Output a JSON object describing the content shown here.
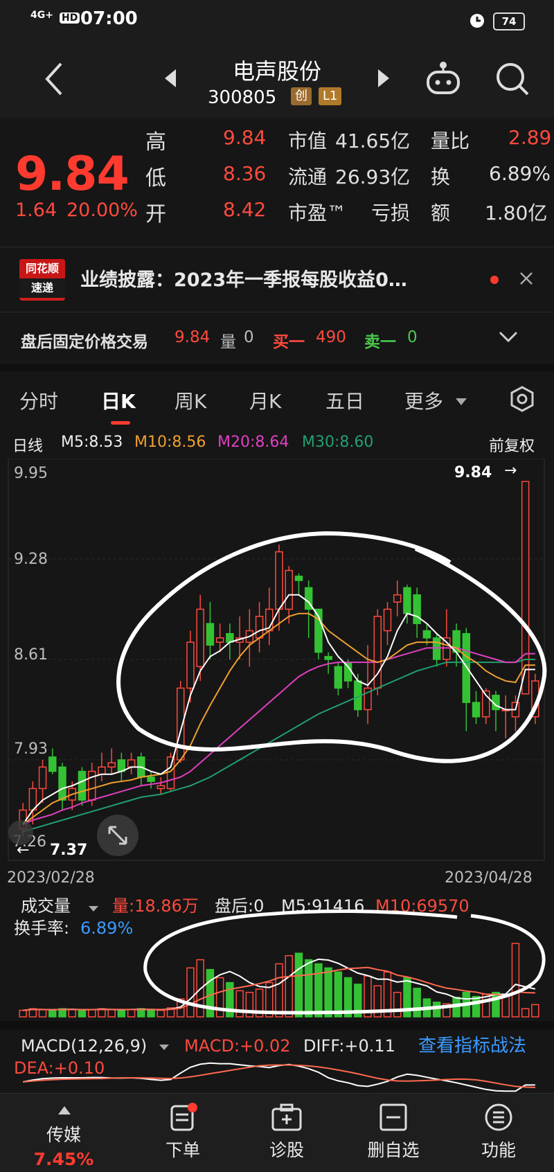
{
  "status": {
    "network": "4G+",
    "hd": "HD",
    "time": "07:00",
    "battery": "74"
  },
  "nav": {
    "title": "电声股份",
    "code": "300805",
    "board_tag": "创",
    "level_tag": "L1"
  },
  "quote": {
    "price": "9.84",
    "change": "1.64",
    "change_pct": "20.00%",
    "rows": [
      {
        "label": "高",
        "value": "9.84",
        "k2": "市值",
        "v2": "41.65亿",
        "k3": "量比",
        "v3": "2.89"
      },
      {
        "label": "低",
        "value": "8.36",
        "k2": "流通",
        "v2": "26.93亿",
        "k3": "换",
        "v3": "6.89%"
      },
      {
        "label": "开",
        "value": "8.42",
        "k2": "市盈™",
        "v2": "亏损",
        "k3": "额",
        "v3": "1.80亿"
      }
    ]
  },
  "news": {
    "logo_top": "同花顺",
    "logo_bottom": "速递",
    "text": "业绩披露：2023年一季报每股收益0…"
  },
  "after_hours": {
    "label": "盘后固定价格交易",
    "price": "9.84",
    "vol_label": "量",
    "vol": "0",
    "buy_label": "买一",
    "buy": "490",
    "sell_label": "卖一",
    "sell": "0"
  },
  "tabs": [
    "分时",
    "日K",
    "周K",
    "月K",
    "五日",
    "更多"
  ],
  "legend": {
    "line": "日线",
    "m5": "M5:8.53",
    "m10": "M10:8.56",
    "m20": "M20:8.64",
    "m30": "M30:8.60",
    "adjust": "前复权"
  },
  "colors": {
    "up": "#ff4a3d",
    "down": "#34c234",
    "m5": "#ffffff",
    "m10": "#f0a030",
    "m20": "#e040c0",
    "m30": "#20a070"
  },
  "chart_data": {
    "type": "candlestick",
    "y_ticks": [
      "9.95",
      "9.28",
      "8.61",
      "7.93",
      "7.26"
    ],
    "ylim": [
      7.2,
      10.0
    ],
    "x_start": "2023/02/28",
    "x_end": "2023/04/28",
    "high_label": "9.84",
    "low_label": "7.37",
    "candles": [
      [
        7.42,
        7.55,
        7.37,
        7.6
      ],
      [
        7.55,
        7.7,
        7.45,
        7.75
      ],
      [
        7.7,
        7.85,
        7.6,
        7.9
      ],
      [
        7.92,
        7.82,
        7.8,
        7.98
      ],
      [
        7.85,
        7.62,
        7.55,
        7.88
      ],
      [
        7.62,
        7.7,
        7.55,
        7.75
      ],
      [
        7.82,
        7.62,
        7.58,
        7.85
      ],
      [
        7.62,
        7.82,
        7.58,
        7.88
      ],
      [
        7.8,
        7.85,
        7.75,
        7.95
      ],
      [
        7.85,
        7.88,
        7.8,
        7.98
      ],
      [
        7.9,
        7.82,
        7.75,
        7.95
      ],
      [
        7.85,
        7.9,
        7.8,
        7.95
      ],
      [
        7.92,
        7.78,
        7.72,
        7.95
      ],
      [
        7.78,
        7.75,
        7.7,
        7.82
      ],
      [
        7.7,
        7.72,
        7.66,
        7.78
      ],
      [
        7.7,
        7.92,
        7.68,
        7.95
      ],
      [
        7.9,
        8.4,
        7.88,
        8.45
      ],
      [
        8.4,
        8.72,
        8.3,
        8.8
      ],
      [
        8.55,
        8.95,
        8.45,
        9.05
      ],
      [
        8.85,
        8.7,
        8.6,
        9.0
      ],
      [
        8.72,
        8.75,
        8.65,
        8.85
      ],
      [
        8.78,
        8.72,
        8.6,
        8.85
      ],
      [
        8.72,
        8.75,
        8.6,
        8.9
      ],
      [
        8.72,
        8.8,
        8.55,
        8.95
      ],
      [
        8.75,
        8.9,
        8.65,
        9.0
      ],
      [
        8.8,
        8.95,
        8.7,
        9.1
      ],
      [
        8.95,
        9.35,
        8.8,
        9.4
      ],
      [
        8.95,
        9.22,
        8.85,
        9.25
      ],
      [
        9.18,
        9.15,
        9.05,
        9.2
      ],
      [
        9.1,
        8.95,
        8.75,
        9.15
      ],
      [
        8.95,
        8.65,
        8.6,
        8.95
      ],
      [
        8.62,
        8.6,
        8.5,
        8.65
      ],
      [
        8.55,
        8.4,
        8.35,
        8.58
      ],
      [
        8.58,
        8.45,
        8.4,
        8.6
      ],
      [
        8.45,
        8.25,
        8.2,
        8.5
      ],
      [
        8.25,
        8.4,
        8.15,
        8.7
      ],
      [
        8.4,
        8.9,
        8.35,
        8.95
      ],
      [
        8.8,
        8.95,
        8.7,
        9.0
      ],
      [
        9.0,
        9.05,
        8.9,
        9.15
      ],
      [
        9.1,
        8.92,
        8.85,
        9.12
      ],
      [
        9.05,
        8.85,
        8.75,
        9.1
      ],
      [
        8.8,
        8.75,
        8.7,
        8.85
      ],
      [
        8.75,
        8.6,
        8.55,
        8.78
      ],
      [
        8.6,
        8.75,
        8.55,
        8.95
      ],
      [
        8.8,
        8.65,
        8.55,
        8.85
      ],
      [
        8.78,
        8.3,
        8.1,
        8.82
      ],
      [
        8.3,
        8.2,
        8.15,
        8.38
      ],
      [
        8.2,
        8.38,
        8.15,
        8.4
      ],
      [
        8.35,
        8.25,
        8.1,
        8.38
      ],
      [
        8.25,
        8.25,
        8.05,
        8.35
      ],
      [
        8.2,
        8.3,
        8.1,
        8.35
      ],
      [
        8.36,
        9.84,
        8.36,
        9.84
      ],
      [
        8.2,
        8.45,
        8.15,
        8.5
      ]
    ],
    "ma": {
      "m5": [
        7.45,
        7.55,
        7.62,
        7.66,
        7.7,
        7.72,
        7.75,
        7.78,
        7.8,
        7.8,
        7.82,
        7.85,
        7.85,
        7.82,
        7.8,
        7.85,
        8.1,
        8.35,
        8.52,
        8.62,
        8.66,
        8.72,
        8.74,
        8.76,
        8.8,
        8.82,
        8.95,
        9.05,
        9.05,
        9.0,
        8.9,
        8.72,
        8.62,
        8.55,
        8.45,
        8.42,
        8.5,
        8.62,
        8.8,
        8.92,
        8.9,
        8.85,
        8.78,
        8.72,
        8.65,
        8.55,
        8.45,
        8.35,
        8.28,
        8.25,
        8.25,
        8.53,
        8.53
      ],
      "m10": [
        7.45,
        7.5,
        7.55,
        7.6,
        7.63,
        7.66,
        7.68,
        7.7,
        7.72,
        7.74,
        7.75,
        7.76,
        7.78,
        7.79,
        7.8,
        7.82,
        7.9,
        8.0,
        8.15,
        8.28,
        8.4,
        8.52,
        8.62,
        8.7,
        8.75,
        8.8,
        8.85,
        8.9,
        8.92,
        8.92,
        8.88,
        8.8,
        8.75,
        8.7,
        8.65,
        8.6,
        8.58,
        8.6,
        8.65,
        8.7,
        8.72,
        8.72,
        8.72,
        8.7,
        8.68,
        8.62,
        8.58,
        8.52,
        8.48,
        8.45,
        8.44,
        8.56,
        8.56
      ],
      "m20": [
        7.45,
        7.48,
        7.5,
        7.52,
        7.55,
        7.57,
        7.6,
        7.62,
        7.64,
        7.66,
        7.68,
        7.7,
        7.72,
        7.73,
        7.74,
        7.76,
        7.78,
        7.82,
        7.88,
        7.94,
        8.0,
        8.06,
        8.12,
        8.18,
        8.24,
        8.3,
        8.36,
        8.42,
        8.48,
        8.52,
        8.55,
        8.57,
        8.58,
        8.58,
        8.58,
        8.58,
        8.58,
        8.6,
        8.62,
        8.64,
        8.66,
        8.68,
        8.68,
        8.68,
        8.68,
        8.66,
        8.64,
        8.62,
        8.6,
        8.58,
        8.58,
        8.64,
        8.64
      ],
      "m30": [
        7.4,
        7.42,
        7.44,
        7.46,
        7.48,
        7.5,
        7.52,
        7.54,
        7.56,
        7.58,
        7.6,
        7.62,
        7.64,
        7.65,
        7.66,
        7.68,
        7.7,
        7.72,
        7.75,
        7.78,
        7.82,
        7.86,
        7.9,
        7.94,
        7.98,
        8.02,
        8.06,
        8.1,
        8.14,
        8.18,
        8.22,
        8.25,
        8.28,
        8.31,
        8.34,
        8.37,
        8.4,
        8.43,
        8.46,
        8.49,
        8.52,
        8.54,
        8.56,
        8.58,
        8.58,
        8.58,
        8.58,
        8.58,
        8.58,
        8.58,
        8.58,
        8.6,
        8.6
      ]
    },
    "volume": {
      "title": "成交量",
      "vol_text": "量:18.86万",
      "after_text": "盘后:0",
      "m5_text": "M5:91416",
      "m10_text": "M10:69570",
      "turnover_label": "换手率:",
      "turnover": "6.89%",
      "bars": [
        8,
        10,
        9,
        8,
        10,
        9,
        8,
        9,
        10,
        9,
        8,
        9,
        10,
        9,
        8,
        11,
        22,
        60,
        70,
        58,
        48,
        42,
        32,
        30,
        34,
        42,
        65,
        75,
        78,
        70,
        65,
        60,
        55,
        48,
        40,
        50,
        38,
        55,
        30,
        48,
        35,
        22,
        18,
        16,
        24,
        30,
        25,
        28,
        30,
        26,
        90,
        10,
        15
      ]
    },
    "macd": {
      "title": "MACD(12,26,9)",
      "macd_text": "MACD:+0.02",
      "diff_text": "DIFF:+0.11",
      "dea_text": "DEA:+0.10",
      "link": "查看指标战法"
    }
  },
  "bottom_tabs": [
    {
      "label": "传媒",
      "sub": "7.45%"
    },
    {
      "label": "下单"
    },
    {
      "label": "诊股"
    },
    {
      "label": "删自选"
    },
    {
      "label": "功能"
    }
  ]
}
